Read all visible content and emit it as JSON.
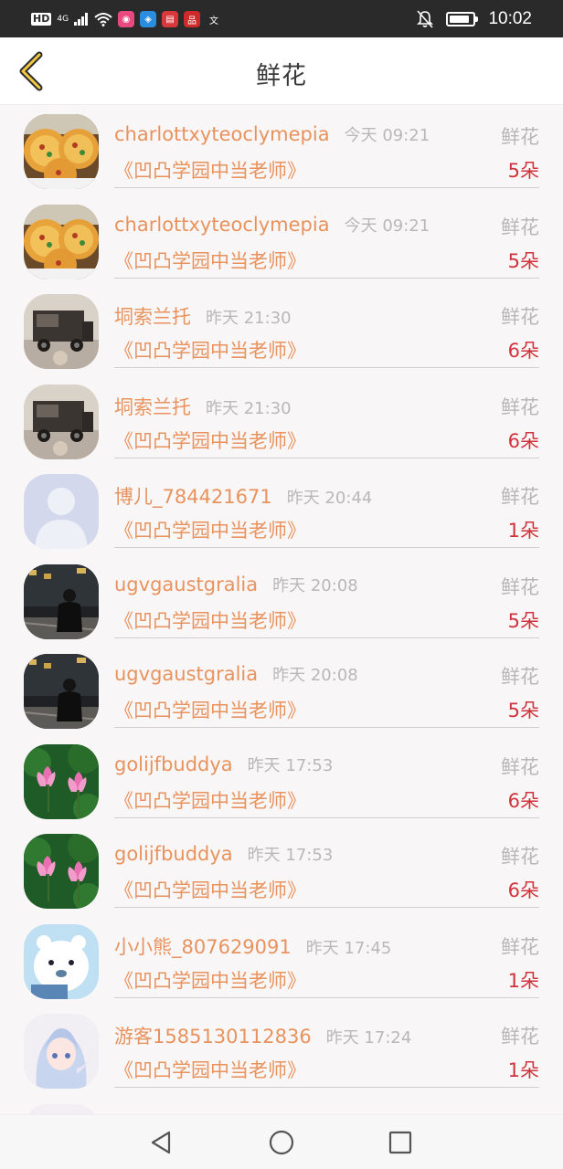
{
  "status_bar": {
    "hd": "HD",
    "network": "4G",
    "time": "10:02",
    "battery_level": 0.85
  },
  "header": {
    "title": "鲜花",
    "back_icon": "chevron-left-icon"
  },
  "colors": {
    "name": "#e8935d",
    "count": "#d0333c",
    "muted": "#b8b8b8",
    "back_accent": "#f5c842"
  },
  "rows": [
    {
      "name": "charlottxyteoclymepia",
      "time": "今天 09:21",
      "gift": "鲜花",
      "book": "《凹凸学园中当老师》",
      "count": "5朵",
      "avatar": "pizza"
    },
    {
      "name": "charlottxyteoclymepia",
      "time": "今天 09:21",
      "gift": "鲜花",
      "book": "《凹凸学园中当老师》",
      "count": "5朵",
      "avatar": "pizza"
    },
    {
      "name": "垌索兰托",
      "time": "昨天 21:30",
      "gift": "鲜花",
      "book": "《凹凸学园中当老师》",
      "count": "6朵",
      "avatar": "truck"
    },
    {
      "name": "垌索兰托",
      "time": "昨天 21:30",
      "gift": "鲜花",
      "book": "《凹凸学园中当老师》",
      "count": "6朵",
      "avatar": "truck"
    },
    {
      "name": "博儿_784421671",
      "time": "昨天 20:44",
      "gift": "鲜花",
      "book": "《凹凸学园中当老师》",
      "count": "1朵",
      "avatar": "default"
    },
    {
      "name": "ugvgaustgralia",
      "time": "昨天 20:08",
      "gift": "鲜花",
      "book": "《凹凸学园中当老师》",
      "count": "5朵",
      "avatar": "night"
    },
    {
      "name": "ugvgaustgralia",
      "time": "昨天 20:08",
      "gift": "鲜花",
      "book": "《凹凸学园中当老师》",
      "count": "5朵",
      "avatar": "night"
    },
    {
      "name": "golijfbuddya",
      "time": "昨天 17:53",
      "gift": "鲜花",
      "book": "《凹凸学园中当老师》",
      "count": "6朵",
      "avatar": "lotus"
    },
    {
      "name": "golijfbuddya",
      "time": "昨天 17:53",
      "gift": "鲜花",
      "book": "《凹凸学园中当老师》",
      "count": "6朵",
      "avatar": "lotus"
    },
    {
      "name": "小小熊_807629091",
      "time": "昨天 17:45",
      "gift": "鲜花",
      "book": "《凹凸学园中当老师》",
      "count": "1朵",
      "avatar": "bear"
    },
    {
      "name": "游客1585130112836",
      "time": "昨天 17:24",
      "gift": "鲜花",
      "book": "《凹凸学园中当老师》",
      "count": "1朵",
      "avatar": "anime"
    },
    {
      "name": "",
      "time": "",
      "gift": "",
      "book": "",
      "count": "",
      "avatar": "anime"
    }
  ],
  "nav": {
    "back": "triangle-back-icon",
    "home": "circle-home-icon",
    "recent": "square-recent-icon"
  }
}
